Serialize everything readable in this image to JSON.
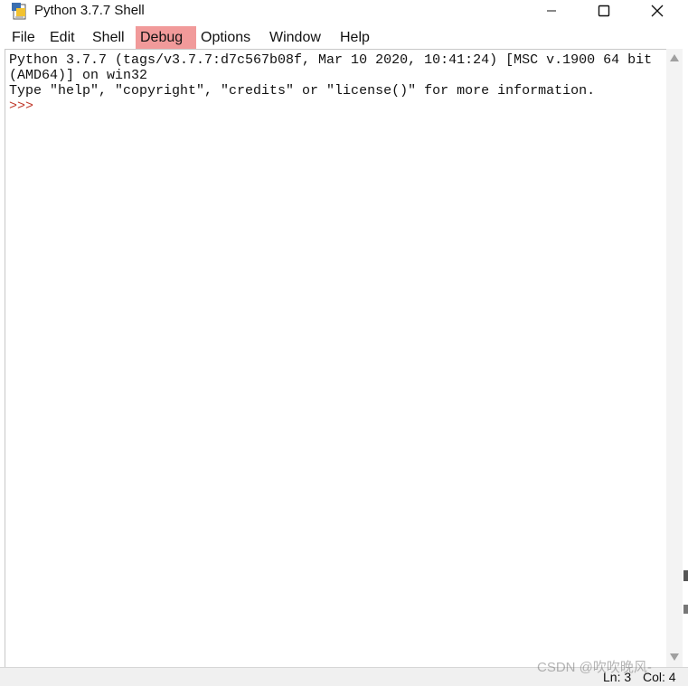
{
  "window": {
    "title": "Python 3.7.7 Shell",
    "controls": {
      "minimize_icon": "minimize-icon",
      "maximize_icon": "maximize-icon",
      "close_icon": "close-icon"
    }
  },
  "menu": {
    "items": [
      "File",
      "Edit",
      "Shell",
      "Debug",
      "Options",
      "Window",
      "Help"
    ],
    "highlighted": "Debug",
    "highlight_color": "#f19a9a"
  },
  "shell": {
    "lines": [
      "Python 3.7.7 (tags/v3.7.7:d7c567b08f, Mar 10 2020, 10:41:24) [MSC v.1900 64 bit",
      "(AMD64)] on win32",
      "Type \"help\", \"copyright\", \"credits\" or \"license()\" for more information."
    ],
    "prompt": ">>>",
    "prompt_color": "#c0392b"
  },
  "status": {
    "line": "Ln: 3",
    "col": "Col: 4"
  },
  "watermark": "CSDN @吹吹晚风-"
}
